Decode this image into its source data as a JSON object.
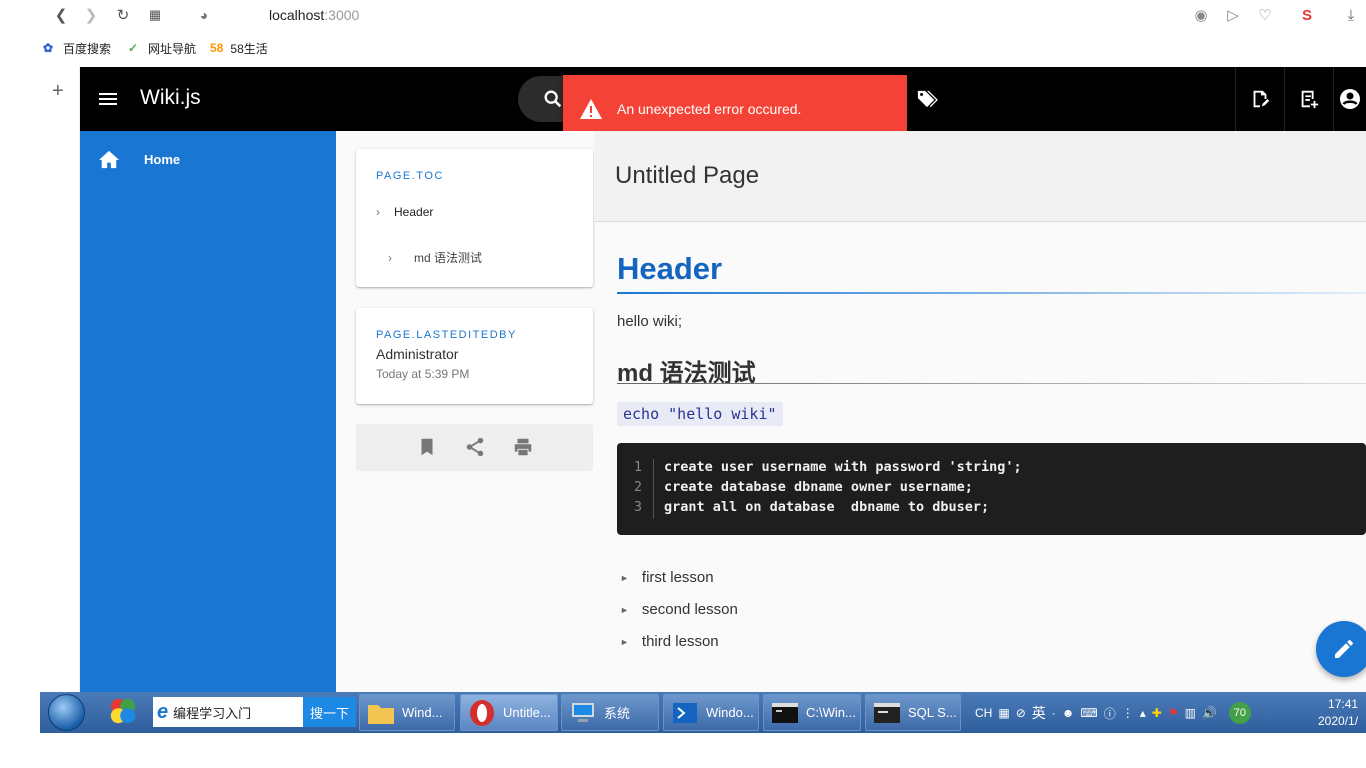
{
  "browser": {
    "url_host": "localhost",
    "url_port": ":3000",
    "bookmarks": [
      {
        "label": "百度搜索"
      },
      {
        "label": "网址导航"
      },
      {
        "label": "58生活",
        "badge": "58"
      }
    ]
  },
  "app": {
    "title": "Wiki.js",
    "error_message": "An unexpected error occured.",
    "sidebar": {
      "home_label": "Home"
    },
    "toc": {
      "heading": "PAGE.TOC",
      "items": [
        "Header",
        "md 语法测试"
      ]
    },
    "last_edited": {
      "heading": "PAGE.LASTEDITEDBY",
      "author": "Administrator",
      "date": "Today at 5:39 PM"
    },
    "page_title": "Untitled Page",
    "content": {
      "h1": "Header",
      "paragraph": "hello wiki;",
      "h2": "md 语法测试",
      "inline_code": "echo \"hello wiki\"",
      "code_lines": [
        {
          "num": "1",
          "text": "create user username with password 'string';"
        },
        {
          "num": "2",
          "text": "create database dbname owner username;"
        },
        {
          "num": "3",
          "text": "grant all on database  dbname to dbuser;"
        }
      ],
      "list": [
        "first lesson",
        "second lesson",
        "third lesson"
      ]
    },
    "colors": {
      "primary": "#1976d2",
      "error": "#f44336",
      "header": "#000000"
    }
  },
  "taskbar": {
    "search_text": "编程学习入门",
    "search_button": "搜一下",
    "tasks": [
      "Wind...",
      "Untitle...",
      "系统",
      "Windo...",
      "C:\\Win...",
      "SQL S..."
    ],
    "tray_lang": "CH",
    "tray_ime": "英",
    "badge": "70",
    "time": "17:41",
    "date": "2020/1/"
  }
}
